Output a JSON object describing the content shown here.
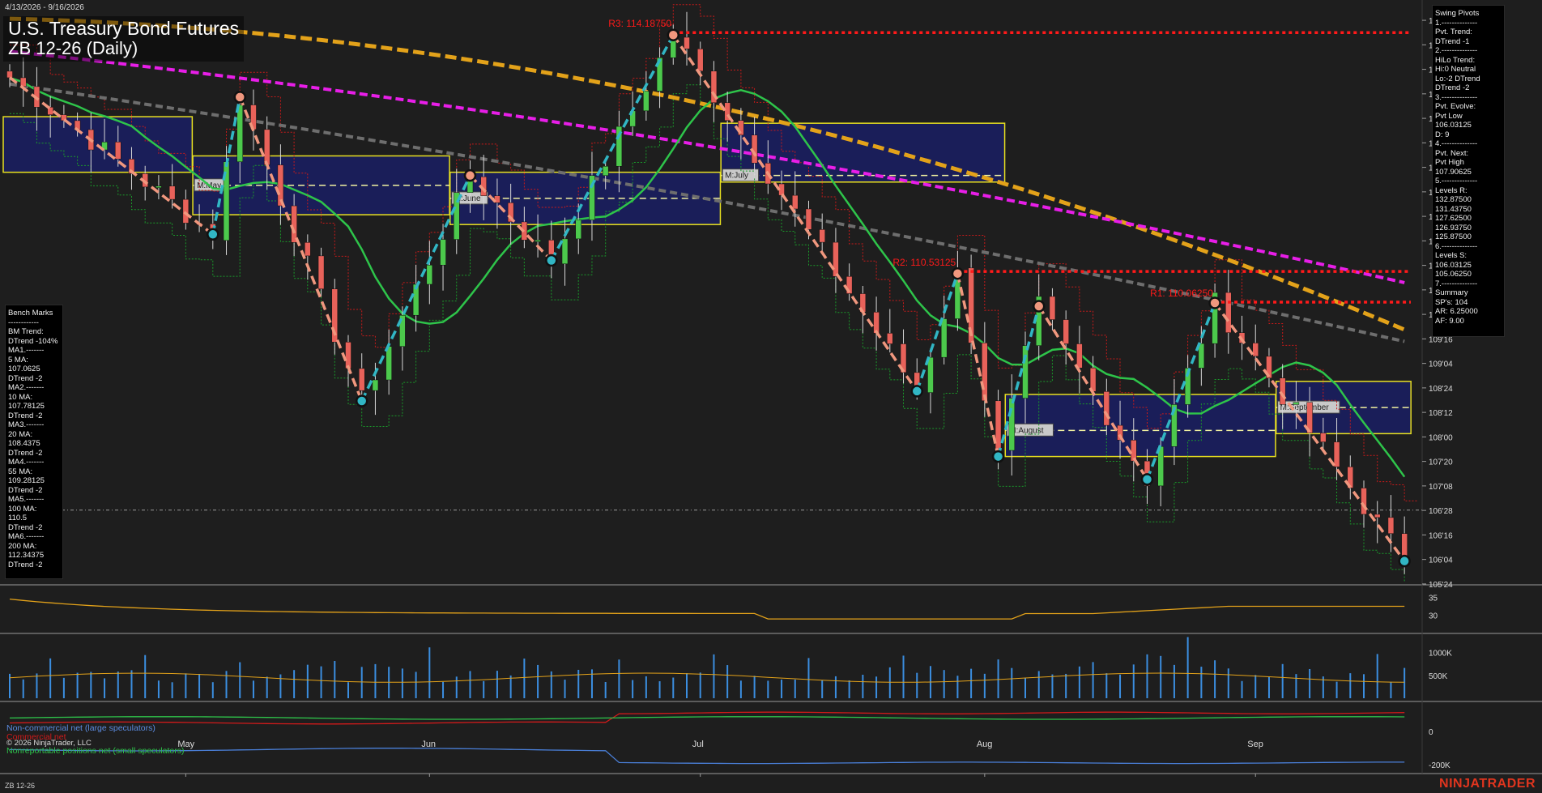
{
  "header": {
    "date_range": "4/13/2026 - 9/16/2026",
    "title": "U.S. Treasury Bond Futures",
    "subtitle": "ZB 12-26 (Daily)"
  },
  "footer": {
    "instrument": "ZB 12-26",
    "brand": "NINJATRADER",
    "copyright": "© 2026 NinjaTrader, LLC"
  },
  "swing_pivots": {
    "lines": [
      "Swing Pivots",
      "1.--------------",
      "Pvt. Trend:",
      "DTrend -1",
      "2.--------------",
      "HiLo Trend:",
      "Hi:0 Neutral",
      "Lo:-2 DTrend",
      "DTrend -2",
      "3.--------------",
      "Pvt. Evolve:",
      "Pvt Low",
      "106.03125",
      "D: 9",
      "4.--------------",
      "Pvt. Next:",
      "Pvt High",
      "107.90625",
      "5.--------------",
      "Levels R:",
      "132.87500",
      "131.43750",
      "127.62500",
      "126.93750",
      "125.87500",
      "6.--------------",
      "Levels S:",
      "106.03125",
      "105.06250",
      "7.--------------",
      "Summary",
      "SP's: 104",
      "AR: 6.25000",
      "AF: 9.00"
    ]
  },
  "bench_marks": {
    "lines": [
      "Bench Marks",
      "------------",
      "BM Trend:",
      "DTrend -104%",
      "MA1.-------",
      "5 MA:",
      "107.0625",
      "DTrend -2",
      "MA2.-------",
      "10 MA:",
      "107.78125",
      "DTrend -2",
      "MA3.-------",
      "20 MA:",
      "108.4375",
      "DTrend -2",
      "MA4.-------",
      "55 MA:",
      "109.28125",
      "DTrend -2",
      "MA5.-------",
      "100 MA:",
      "110.5",
      "DTrend -2",
      "MA6.-------",
      "200 MA:",
      "112.34375",
      "DTrend -2"
    ]
  },
  "legend": {
    "noncommercial": "Non-commercial net (large speculators)",
    "commercial": "Commercial net",
    "nonreportable": "Nonreportable positions net (small speculators)"
  },
  "colors": {
    "background": "#1e1e1e",
    "bull_candle": "#4cc94c",
    "bear_candle": "#e8625a",
    "ma_green": "#2ec44a",
    "ma_gray": "#6e6e6e",
    "ma_magenta": "#e81ee8",
    "ma_orange": "#e3a21a",
    "swing_up": "#31b6c4",
    "swing_down": "#f0977e",
    "resistance": "#ff1a1a",
    "box_fill": "#1a1f6e",
    "box_border": "#e8e020",
    "volume": "#3b8ee0",
    "cot_noncommercial": "#4a7fd8",
    "cot_commercial": "#d11a1a",
    "cot_nonreportable": "#2ec44a"
  },
  "chart_data": {
    "type": "candlestick",
    "price_axis": {
      "ylim": [
        105.6,
        114.5
      ],
      "ticks": [
        "114'12",
        "114'00",
        "113'20",
        "113'08",
        "112'28",
        "112'16",
        "112'04",
        "111'24",
        "111'12",
        "111'00",
        "110'20",
        "110'08",
        "109'28",
        "109'16",
        "109'04",
        "108'24",
        "108'12",
        "108'00",
        "107'20",
        "107'08",
        "106'28",
        "106'16",
        "106'04",
        "105'24"
      ],
      "tick_values": [
        114.375,
        114.0,
        113.625,
        113.25,
        112.875,
        112.5,
        112.125,
        111.75,
        111.375,
        111.0,
        110.625,
        110.25,
        109.875,
        109.5,
        109.125,
        108.75,
        108.375,
        108.0,
        107.625,
        107.25,
        106.875,
        106.5,
        106.125,
        105.75
      ]
    },
    "x_axis": {
      "months": [
        "May",
        "Jun",
        "Jul",
        "Aug",
        "Sep"
      ],
      "month_bar_index": [
        13,
        31,
        51,
        72,
        92
      ],
      "num_bars": 104
    },
    "resistance_levels": [
      {
        "label": "R3: 114.18750",
        "value": 114.1875,
        "start_bar": 49
      },
      {
        "label": "R2: 110.53125",
        "value": 110.53125,
        "start_bar": 70
      },
      {
        "label": "R1: 110.06250",
        "value": 110.0625,
        "start_bar": 89
      }
    ],
    "swing_pivots": [
      {
        "bar": 0,
        "price": 113.5
      },
      {
        "bar": 15,
        "price": 111.1
      },
      {
        "bar": 17,
        "price": 113.2
      },
      {
        "bar": 26,
        "price": 108.55
      },
      {
        "bar": 34,
        "price": 112.0
      },
      {
        "bar": 40,
        "price": 110.7
      },
      {
        "bar": 49,
        "price": 114.15
      },
      {
        "bar": 67,
        "price": 108.7
      },
      {
        "bar": 70,
        "price": 110.5
      },
      {
        "bar": 73,
        "price": 107.7
      },
      {
        "bar": 76,
        "price": 110.0
      },
      {
        "bar": 84,
        "price": 107.35
      },
      {
        "bar": 89,
        "price": 110.05
      },
      {
        "bar": 103,
        "price": 106.1
      }
    ],
    "monthly_boxes": [
      {
        "label": "M:May",
        "start_bar": 14,
        "end_bar": 32,
        "high": 112.3,
        "low": 111.4,
        "mid": 111.85
      },
      {
        "label": "M:June",
        "start_bar": 33,
        "end_bar": 52,
        "high": 112.05,
        "low": 111.25,
        "mid": 111.65
      },
      {
        "label": "M:July",
        "start_bar": 53,
        "end_bar": 73,
        "high": 112.8,
        "low": 111.9,
        "mid": 112.0
      },
      {
        "label": "M:August",
        "start_bar": 74,
        "end_bar": 93,
        "high": 108.65,
        "low": 107.7,
        "mid": 108.1
      },
      {
        "label": "M:September",
        "start_bar": 94,
        "end_bar": 103,
        "high": 108.85,
        "low": 108.05,
        "mid": 108.45
      }
    ],
    "prior_box": {
      "start_bar": 0,
      "end_bar": 13,
      "high": 112.9,
      "low": 112.05
    },
    "current_price": 106.88,
    "oscillator": {
      "ticks": [
        "35",
        "30"
      ],
      "tick_values": [
        35,
        30
      ],
      "ylim": [
        25,
        38
      ]
    },
    "volume": {
      "ticks": [
        "1000K",
        "500K"
      ],
      "tick_values": [
        1000,
        500
      ],
      "ylim": [
        0,
        1350
      ]
    },
    "cot": {
      "ticks": [
        "0",
        "-200K"
      ],
      "tick_values": [
        0,
        -200
      ],
      "ylim": [
        -240,
        160
      ]
    }
  }
}
